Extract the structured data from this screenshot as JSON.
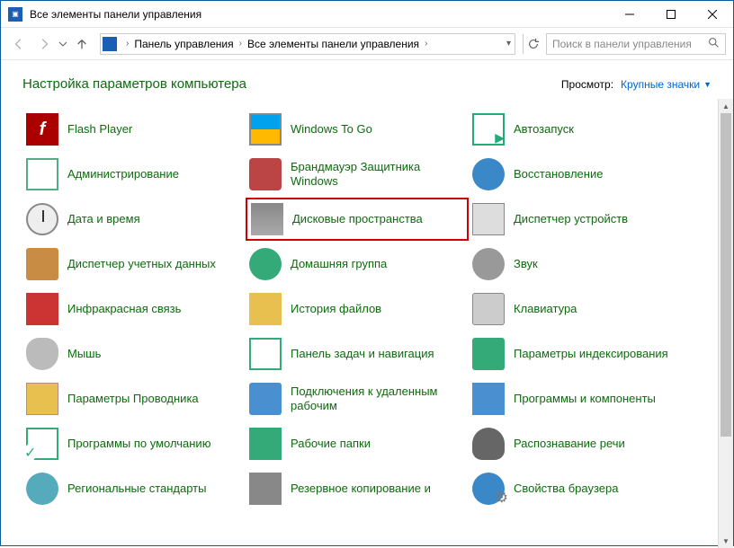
{
  "window": {
    "title": "Все элементы панели управления"
  },
  "breadcrumb": {
    "root": "Панель управления",
    "current": "Все элементы панели управления"
  },
  "search": {
    "placeholder": "Поиск в панели управления"
  },
  "header": {
    "title": "Настройка параметров компьютера",
    "view_label": "Просмотр:",
    "view_value": "Крупные значки"
  },
  "items": [
    {
      "name": "flash-player",
      "label": "Flash Player",
      "icon": "i-flash"
    },
    {
      "name": "windows-to-go",
      "label": "Windows To Go",
      "icon": "i-wtg"
    },
    {
      "name": "autoplay",
      "label": "Автозапуск",
      "icon": "i-auto"
    },
    {
      "name": "administration",
      "label": "Администрирование",
      "icon": "i-admin"
    },
    {
      "name": "windows-defender-firewall",
      "label": "Брандмауэр Защитника Windows",
      "icon": "i-fw"
    },
    {
      "name": "recovery",
      "label": "Восстановление",
      "icon": "i-recov"
    },
    {
      "name": "date-time",
      "label": "Дата и время",
      "icon": "i-time"
    },
    {
      "name": "storage-spaces",
      "label": "Дисковые пространства",
      "icon": "i-disk",
      "highlighted": true
    },
    {
      "name": "device-manager",
      "label": "Диспетчер устройств",
      "icon": "i-devmgr"
    },
    {
      "name": "credential-manager",
      "label": "Диспетчер учетных данных",
      "icon": "i-cred"
    },
    {
      "name": "homegroup",
      "label": "Домашняя группа",
      "icon": "i-home"
    },
    {
      "name": "sound",
      "label": "Звук",
      "icon": "i-sound"
    },
    {
      "name": "infrared",
      "label": "Инфракрасная связь",
      "icon": "i-ir"
    },
    {
      "name": "file-history",
      "label": "История файлов",
      "icon": "i-hist"
    },
    {
      "name": "keyboard",
      "label": "Клавиатура",
      "icon": "i-kb"
    },
    {
      "name": "mouse",
      "label": "Мышь",
      "icon": "i-mouse"
    },
    {
      "name": "taskbar-navigation",
      "label": "Панель задач и навигация",
      "icon": "i-task"
    },
    {
      "name": "indexing-options",
      "label": "Параметры индексирования",
      "icon": "i-index"
    },
    {
      "name": "explorer-options",
      "label": "Параметры Проводника",
      "icon": "i-explorer"
    },
    {
      "name": "remote-connections",
      "label": "Подключения к удаленным рабочим",
      "icon": "i-remote"
    },
    {
      "name": "programs-components",
      "label": "Программы и компоненты",
      "icon": "i-prog"
    },
    {
      "name": "default-programs",
      "label": "Программы по умолчанию",
      "icon": "i-default"
    },
    {
      "name": "work-folders",
      "label": "Рабочие папки",
      "icon": "i-work"
    },
    {
      "name": "speech-recognition",
      "label": "Распознавание речи",
      "icon": "i-speech"
    },
    {
      "name": "regional-options",
      "label": "Региональные стандарты",
      "icon": "i-region"
    },
    {
      "name": "backup-restore",
      "label": "Резервное копирование и",
      "icon": "i-backup"
    },
    {
      "name": "browser-properties",
      "label": "Свойства браузера",
      "icon": "i-browser"
    }
  ]
}
